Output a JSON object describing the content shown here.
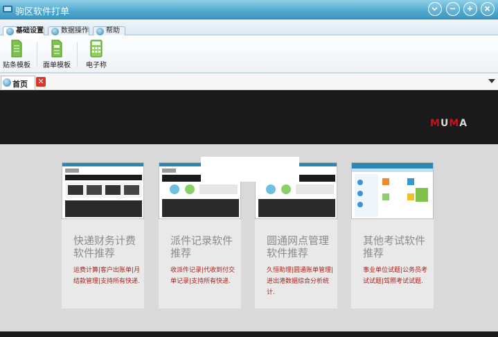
{
  "window": {
    "title": "驹区软件打单",
    "controls": [
      "dropdown-icon",
      "minimize-icon",
      "maximize-icon",
      "close-icon"
    ]
  },
  "ribbon": {
    "tabs": [
      {
        "label": "基础设置",
        "active": true
      },
      {
        "label": "数据操作",
        "active": false
      },
      {
        "label": "帮助",
        "active": false
      }
    ],
    "buttons": [
      {
        "label": "贴条模板",
        "icon": "label-template-icon"
      },
      {
        "label": "面单模板",
        "icon": "waybill-template-icon"
      },
      {
        "label": "电子称",
        "icon": "scale-icon"
      }
    ]
  },
  "doc_tabs": {
    "home_label": "首页",
    "close_symbol": "✕"
  },
  "banner": {
    "logo_parts": [
      "M",
      "U",
      "M",
      "A"
    ]
  },
  "cards": [
    {
      "title": "快递财务计费软件推荐",
      "desc": "运费计算|客户出账单|月结款管理|支持所有快递."
    },
    {
      "title": "派件记录软件推荐",
      "desc": "收派件记录|代收到付交单记录|支持所有快递."
    },
    {
      "title": "圆通网点管理软件推荐",
      "desc": "久恒助理|圆通账单管理|进出港数据综合分析统计."
    },
    {
      "title": "其他考试软件推荐",
      "desc": "事业单位试题|公务员考试试题|驾照考试试题."
    }
  ],
  "colors": {
    "titlebar": "#4fa8cf",
    "banner": "#1a1a1a",
    "accent_red": "#c5141b",
    "desc_text": "#a7241c"
  }
}
